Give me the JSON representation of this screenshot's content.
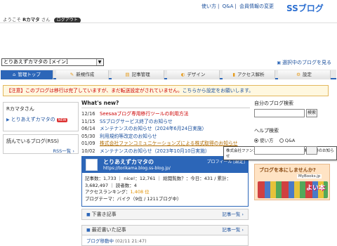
{
  "header": {
    "links": [
      "使い方",
      "Q&A",
      "会員情報の変更"
    ],
    "logo": "SSブログ",
    "welcome_prefix": "ようこそ",
    "user_name": "Rカマタ",
    "welcome_suffix": "さん",
    "logout": "ログアウト"
  },
  "blog_select": {
    "value": "とりあえずカマタの [メイン]"
  },
  "view_blog_link": "選択中のブログを見る",
  "nav": {
    "tabs": [
      {
        "label": "管理トップ",
        "icon": "home-icon",
        "glyph": "⌂"
      },
      {
        "label": "新規作成",
        "icon": "pencil-icon",
        "glyph": "✎"
      },
      {
        "label": "記事管理",
        "icon": "document-icon",
        "glyph": "▤"
      },
      {
        "label": "デザイン",
        "icon": "palette-icon",
        "glyph": "◐"
      },
      {
        "label": "アクセス解析",
        "icon": "chart-icon",
        "glyph": "▮"
      },
      {
        "label": "設定",
        "icon": "gear-icon",
        "glyph": "⚙"
      }
    ]
  },
  "notice": {
    "text": "【注意】このブログは移行は完了していますが、まだ転送設定がされていません。",
    "link": "こちらから設定をお願いします。"
  },
  "user_box": {
    "name": "Rカマタさん",
    "blog": "とりあえずカマタの",
    "tag": "NEW"
  },
  "reading": {
    "title": "読んでいるブログ(RSS)",
    "more": "RSS一覧"
  },
  "whats_new": {
    "title": "What's new?",
    "items": [
      {
        "date": "12/16",
        "text": "Seesaaブログ専用移行ツールの利用方法",
        "style": "r"
      },
      {
        "date": "11/15",
        "text": "SSブログサービス終了のお知らせ",
        "style": "n"
      },
      {
        "date": "06/14",
        "text": "メンテナンスのお知らせ（2024年6月24日実施）",
        "style": "n"
      },
      {
        "date": "05/30",
        "text": "利用規約等改定のお知らせ",
        "style": "n"
      },
      {
        "date": "01/09",
        "text": "株式会社ファンコミュニケーションズによる株式取得のお知らせ",
        "style": "o"
      },
      {
        "date": "10/02",
        "text": "メンテナンスのお知らせ（2023年10月10日実施）",
        "style": "n"
      }
    ]
  },
  "tooltip": "株式会社ファンコミュニケーションズによる株式取得のお知らせ",
  "blog_card": {
    "name": "とりあえずカマタの",
    "url": "https://torikama.blog.ss-blog.jp/",
    "profile": "プロフィール [設定]",
    "line1": "記事数：1,733 ｜ nice!：12,761 ｜ 総閲覧数？：今日：431 / 累計：",
    "line2": "3,682,497 ｜ 読者数：4",
    "rank_label": "アクセスランキング：",
    "rank_value": "1,408 位",
    "theme": "ブログテーマ：バイク（9位 / 1211ブログ中）"
  },
  "drafts": {
    "title": "下書き記事",
    "more": "記事一覧"
  },
  "recent": {
    "title": "最近書いた記事",
    "more": "記事一覧",
    "item": "ブログ移動中",
    "date": "(02/11 21:47)"
  },
  "right": {
    "search_title": "自分のブログ検索",
    "search_button": "検索",
    "help_title": "ヘルプ検索",
    "help_options": [
      "使い方",
      "Q&A"
    ],
    "banner_title": "ブログを本にしませんか?",
    "banner_brand": "MyBooks.jp",
    "banner_tagline": "よい本"
  },
  "colors": {
    "accent": "#2c66b8",
    "alert": "#cc0000"
  }
}
